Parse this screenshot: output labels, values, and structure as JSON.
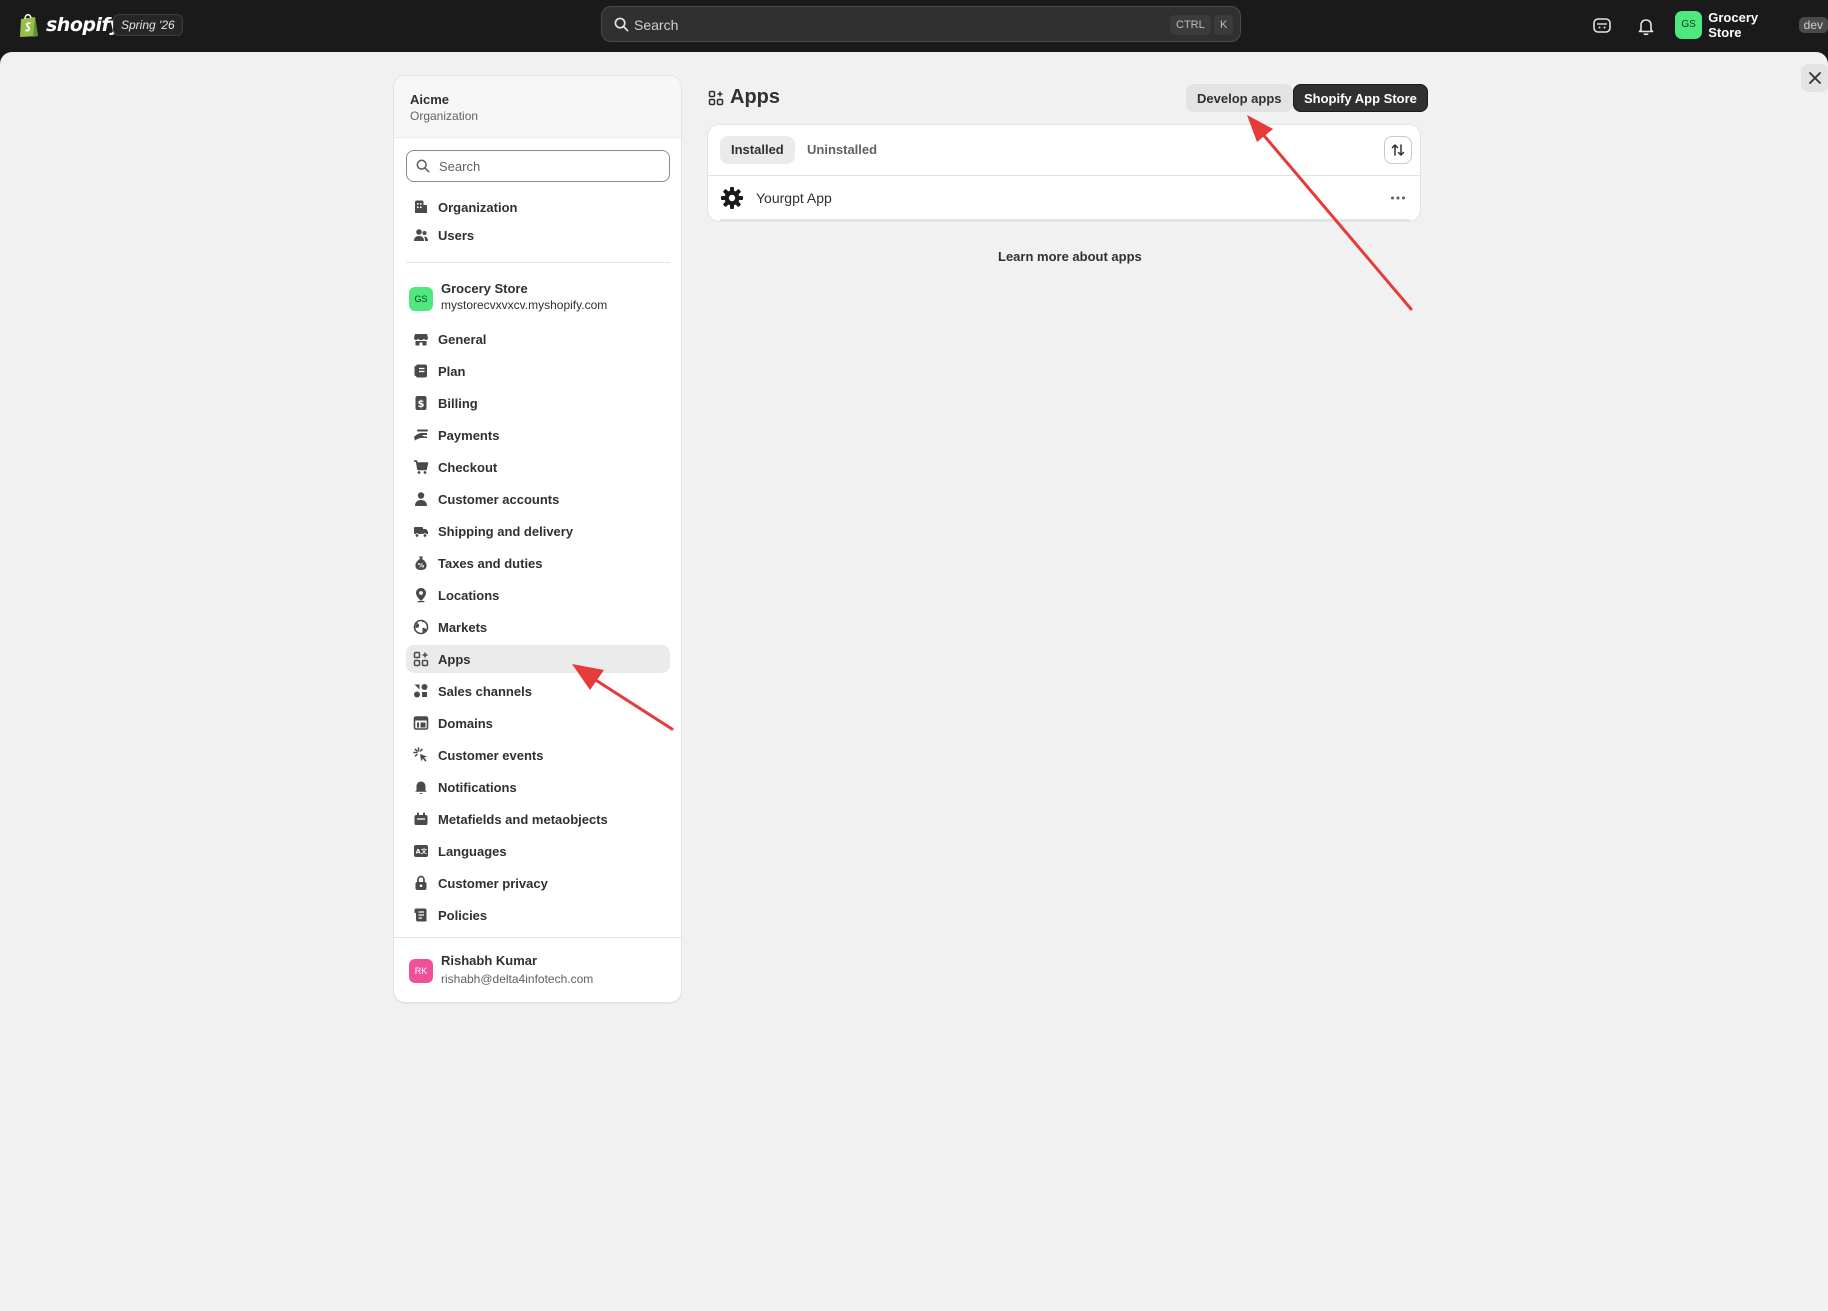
{
  "topbar": {
    "logo_text": "shopify",
    "release_badge": "Spring '26",
    "search_placeholder": "Search",
    "shortcut_ctrl": "CTRL",
    "shortcut_k": "K",
    "store_initials": "GS",
    "store_name": "Grocery Store",
    "store_badge": "dev"
  },
  "sidebar": {
    "org_name": "Aicme",
    "org_subtitle": "Organization",
    "search_placeholder": "Search",
    "org_items": [
      {
        "label": "Organization",
        "icon": "building-icon"
      },
      {
        "label": "Users",
        "icon": "users-icon"
      }
    ],
    "store": {
      "initials": "GS",
      "name": "Grocery Store",
      "domain": "mystorecvxvxcv.myshopify.com"
    },
    "store_items": [
      {
        "label": "General",
        "icon": "store-icon"
      },
      {
        "label": "Plan",
        "icon": "plan-icon"
      },
      {
        "label": "Billing",
        "icon": "billing-icon"
      },
      {
        "label": "Payments",
        "icon": "payments-icon"
      },
      {
        "label": "Checkout",
        "icon": "cart-icon"
      },
      {
        "label": "Customer accounts",
        "icon": "person-icon"
      },
      {
        "label": "Shipping and delivery",
        "icon": "truck-icon"
      },
      {
        "label": "Taxes and duties",
        "icon": "tax-icon"
      },
      {
        "label": "Locations",
        "icon": "location-icon"
      },
      {
        "label": "Markets",
        "icon": "globe-icon"
      },
      {
        "label": "Apps",
        "icon": "apps-icon",
        "active": true
      },
      {
        "label": "Sales channels",
        "icon": "channels-icon"
      },
      {
        "label": "Domains",
        "icon": "domains-icon"
      },
      {
        "label": "Customer events",
        "icon": "events-icon"
      },
      {
        "label": "Notifications",
        "icon": "bell-icon"
      },
      {
        "label": "Metafields and metaobjects",
        "icon": "metafields-icon"
      },
      {
        "label": "Languages",
        "icon": "languages-icon"
      },
      {
        "label": "Customer privacy",
        "icon": "lock-icon"
      },
      {
        "label": "Policies",
        "icon": "policies-icon"
      }
    ],
    "user": {
      "initials": "RK",
      "name": "Rishabh Kumar",
      "email": "rishabh@delta4infotech.com"
    }
  },
  "main": {
    "title": "Apps",
    "develop_apps_label": "Develop apps",
    "app_store_label": "Shopify App Store",
    "tabs": [
      {
        "label": "Installed",
        "active": true
      },
      {
        "label": "Uninstalled",
        "active": false
      }
    ],
    "apps": [
      {
        "name": "Yourgpt App",
        "icon": "gear-icon"
      }
    ],
    "learn_more": "Learn more about apps"
  },
  "colors": {
    "topbar_bg": "#1a1a1a",
    "page_bg": "#f1f1f1",
    "store_avatar": "#4ee87f",
    "user_avatar": "#f0509a",
    "primary_button": "#303030",
    "annotation_arrow": "#e53b3b"
  }
}
